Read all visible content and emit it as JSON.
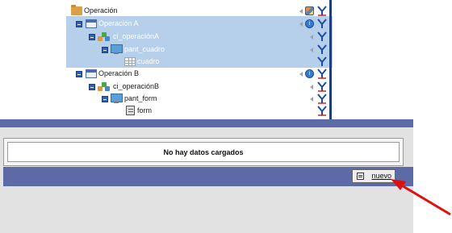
{
  "tree": {
    "nodes": [
      {
        "label": "Operación",
        "type": "folder",
        "selected": false
      },
      {
        "label": "Operación A",
        "type": "window",
        "selected": true
      },
      {
        "label": "ci_operaciónA",
        "type": "blocks",
        "selected": true
      },
      {
        "label": "pant_cuadro",
        "type": "screen",
        "selected": true
      },
      {
        "label": "cuadro",
        "type": "grid",
        "selected": true
      },
      {
        "label": "Operación B",
        "type": "window",
        "selected": false
      },
      {
        "label": "ci_operaciónB",
        "type": "blocks",
        "selected": false
      },
      {
        "label": "pant_form",
        "type": "screen",
        "selected": false
      },
      {
        "label": "form",
        "type": "form",
        "selected": false
      }
    ],
    "icons": {
      "expand": "minus-toggle-icon",
      "collapse_arrow": "arrow-left-icon",
      "edit": "edit-badge-icon",
      "info": "info-circle-icon",
      "tool": "tool-icon"
    }
  },
  "panel": {
    "message": "No hay datos cargados"
  },
  "actions": {
    "nuevo_label": "nuevo",
    "nuevo_icon": "document-icon"
  },
  "colors": {
    "bar": "#5c6aa8",
    "selection": "#a9c8e8",
    "annotation_arrow": "#e01010",
    "panel_bg": "#e2e2e2"
  }
}
